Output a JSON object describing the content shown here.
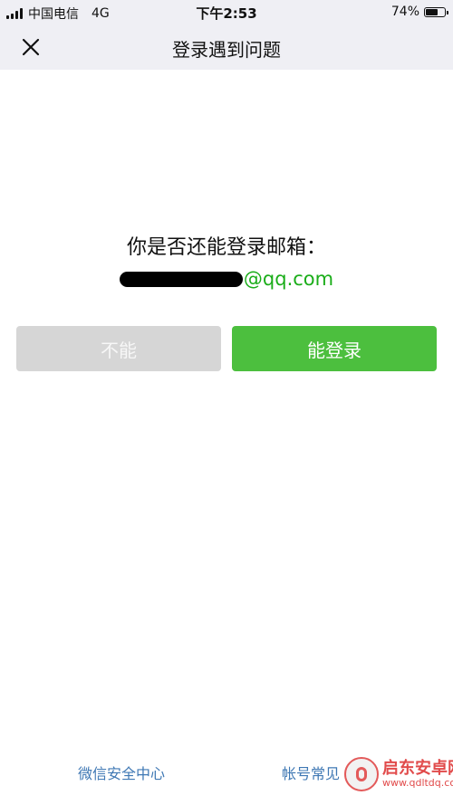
{
  "status_bar": {
    "carrier": "中国电信",
    "network": "4G",
    "time": "下午2:53",
    "battery_percent": "74%",
    "battery_level": 0.74,
    "signal_bars": 4
  },
  "nav": {
    "close_icon": "close-icon",
    "title": "登录遇到问题"
  },
  "main": {
    "question": "你是否还能登录邮箱：",
    "email_domain": "@qq.com",
    "email_domain_color": "#1aad19",
    "btn_no_label": "不能",
    "btn_yes_label": "能登录",
    "btn_yes_color": "#4cbf3e"
  },
  "footer": {
    "security_center": "微信安全中心",
    "account_faq": "帐号常见"
  },
  "watermark": {
    "title": "启东安卓网",
    "url": "www.qdltdq.com"
  }
}
